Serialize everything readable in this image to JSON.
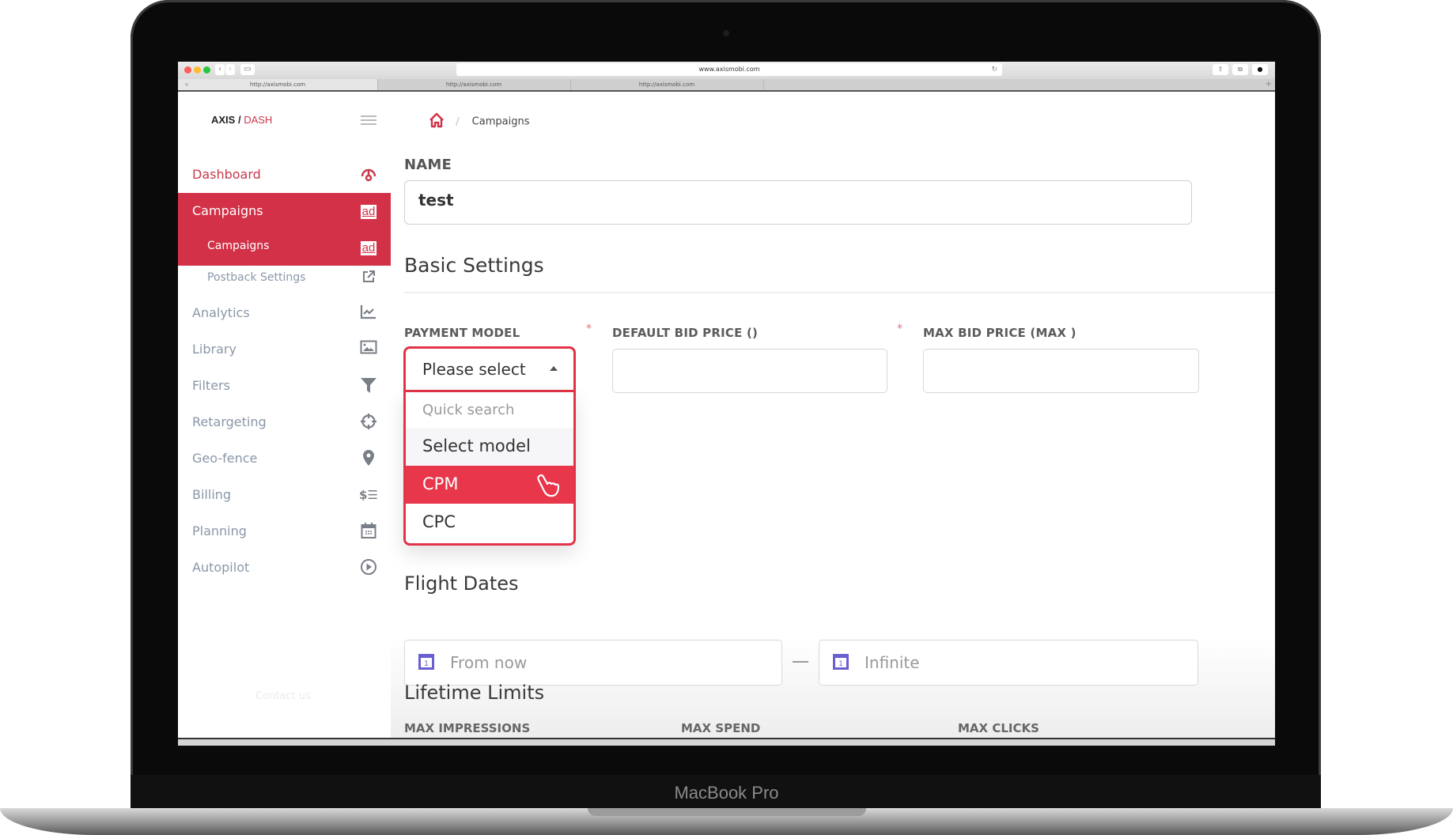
{
  "device": {
    "label": "MacBook Pro"
  },
  "browser": {
    "url": "www.axismobi.com",
    "tabs": [
      {
        "label": "http://axismobi.com"
      },
      {
        "label": "http://axismobi.com"
      },
      {
        "label": "http://axismobi.com"
      }
    ],
    "tab_close": "×",
    "new_tab": "+"
  },
  "app": {
    "logo_part1": "AXIS / ",
    "logo_part2": "DASH",
    "accent_color": "#d33148"
  },
  "breadcrumb": {
    "current": "Campaigns",
    "separator": "/"
  },
  "sidebar": {
    "items": [
      {
        "label": "Dashboard",
        "icon": "dashboard-gauge-icon"
      },
      {
        "label": "Campaigns",
        "icon": "ad-icon",
        "badge": "ad"
      },
      {
        "label": "Campaigns",
        "icon": "ad-icon",
        "badge": "ad"
      },
      {
        "label": "Postback Settings",
        "icon": "external-link-icon"
      },
      {
        "label": "Analytics",
        "icon": "chart-line-icon"
      },
      {
        "label": "Library",
        "icon": "image-icon"
      },
      {
        "label": "Filters",
        "icon": "filter-icon"
      },
      {
        "label": "Retargeting",
        "icon": "crosshair-icon"
      },
      {
        "label": "Geo-fence",
        "icon": "map-pin-icon"
      },
      {
        "label": "Billing",
        "icon": "billing-icon"
      },
      {
        "label": "Planning",
        "icon": "calendar-icon"
      },
      {
        "label": "Autopilot",
        "icon": "play-circle-icon"
      }
    ],
    "contact": "Contact us"
  },
  "form": {
    "name_label": "NAME",
    "name_value": "test",
    "basic_settings_title": "Basic Settings",
    "payment_model_label": "PAYMENT MODEL",
    "payment_model_value": "Please select",
    "required_mark": "*",
    "default_bid_label": "DEFAULT BID PRICE ()",
    "default_bid_value": "",
    "max_bid_label": "MAX BID PRICE (MAX )",
    "max_bid_value": "",
    "dropdown": {
      "search_placeholder": "Quick search",
      "group_header": "Select model",
      "options": [
        "CPM",
        "CPC"
      ],
      "highlighted": "CPM"
    },
    "flight_dates_title": "Flight Dates",
    "from_placeholder": "From now",
    "to_placeholder": "Infinite",
    "date_separator": "—",
    "lifetime_limits_title": "Lifetime Limits",
    "max_impressions_label": "MAX IMPRESSIONS",
    "max_spend_label": "MAX SPEND",
    "max_clicks_label": "MAX CLICKS"
  }
}
